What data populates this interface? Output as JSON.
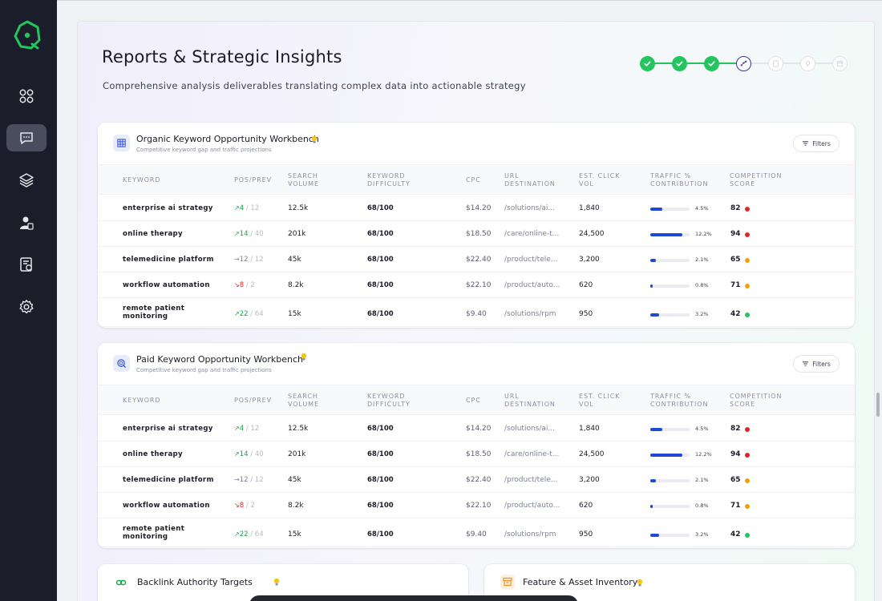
{
  "header": {
    "title": "Reports & Strategic Insights",
    "subtitle": "Comprehensive analysis deliverables translating complex data into actionable strategy"
  },
  "sidebar": {
    "items": [
      {
        "name": "dashboard-grid-icon",
        "active": false
      },
      {
        "name": "chat-icon",
        "active": true
      },
      {
        "name": "layers-icon",
        "active": false
      },
      {
        "name": "user-icon",
        "active": false
      },
      {
        "name": "report-icon",
        "active": false
      },
      {
        "name": "gear-icon",
        "active": false
      }
    ]
  },
  "stepper": {
    "steps": [
      "done",
      "done",
      "done",
      "current",
      "future",
      "future",
      "future"
    ]
  },
  "columns": {
    "keyword": "KEYWORD",
    "pos": "POS/PREV",
    "volume_1": "SEARCH",
    "volume_2": "VOLUME",
    "difficulty_1": "KEYWORD",
    "difficulty_2": "DIFFICULTY",
    "cpc": "CPC",
    "url_1": "URL",
    "url_2": "DESTINATION",
    "click_1": "EST. CLICK",
    "click_2": "VOL",
    "traffic_1": "TRAFFIC %",
    "traffic_2": "CONTRIBUTION",
    "competition_1": "COMPETITION",
    "competition_2": "SCORE"
  },
  "organic": {
    "title": "Organic Keyword Opportunity Workbench",
    "subtitle": "Competitive keyword gap and traffic projections",
    "filters_label": "Filters",
    "rows": [
      {
        "kw1": "enterprise ai strategy",
        "kw2": "",
        "dir": "up",
        "arrow": "↗",
        "pos": "4",
        "prev": "/ 12",
        "vol": "12.5k",
        "diff": "68/100",
        "cpc": "$14.20",
        "url": "/solutions/ai...",
        "click": "1,840",
        "traffic": 4.5,
        "pct": "4.5%",
        "score": "82",
        "color": "#dc2626"
      },
      {
        "kw1": "online therapy",
        "kw2": "",
        "dir": "up",
        "arrow": "↗",
        "pos": "14",
        "prev": "/ 40",
        "vol": "201k",
        "diff": "68/100",
        "cpc": "$18.50",
        "url": "/care/online-t...",
        "click": "24,500",
        "traffic": 12.2,
        "pct": "12.2%",
        "score": "94",
        "color": "#dc2626"
      },
      {
        "kw1": "telemedicine platform",
        "kw2": "",
        "dir": "flat",
        "arrow": "→",
        "pos": "12",
        "prev": "/ 12",
        "vol": "45k",
        "diff": "68/100",
        "cpc": "$22.40",
        "url": "/product/tele...",
        "click": "3,200",
        "traffic": 2.1,
        "pct": "2.1%",
        "score": "65",
        "color": "#f59e0b"
      },
      {
        "kw1": "workflow automation",
        "kw2": "",
        "dir": "down",
        "arrow": "↘",
        "pos": "8",
        "prev": "/ 2",
        "vol": "8.2k",
        "diff": "68/100",
        "cpc": "$22.10",
        "url": "/product/auto...",
        "click": "620",
        "traffic": 0.8,
        "pct": "0.8%",
        "score": "71",
        "color": "#f59e0b"
      },
      {
        "kw1": "remote patient",
        "kw2": "monitoring",
        "dir": "up",
        "arrow": "↗",
        "pos": "22",
        "prev": "/ 64",
        "vol": "15k",
        "diff": "68/100",
        "cpc": "$9.40",
        "url": "/solutions/rpm",
        "click": "950",
        "traffic": 3.2,
        "pct": "3.2%",
        "score": "42",
        "color": "#22c55e"
      }
    ]
  },
  "paid": {
    "title": "Paid Keyword Opportunity Workbench",
    "subtitle": "Competitive keyword gap and traffic projections",
    "filters_label": "Filters",
    "rows": [
      {
        "kw1": "enterprise ai strategy",
        "kw2": "",
        "dir": "up",
        "arrow": "↗",
        "pos": "4",
        "prev": "/ 12",
        "vol": "12.5k",
        "diff": "68/100",
        "cpc": "$14.20",
        "url": "/solutions/ai...",
        "click": "1,840",
        "traffic": 4.5,
        "pct": "4.5%",
        "score": "82",
        "color": "#dc2626"
      },
      {
        "kw1": "online therapy",
        "kw2": "",
        "dir": "up",
        "arrow": "↗",
        "pos": "14",
        "prev": "/ 40",
        "vol": "201k",
        "diff": "68/100",
        "cpc": "$18.50",
        "url": "/care/online-t...",
        "click": "24,500",
        "traffic": 12.2,
        "pct": "12.2%",
        "score": "94",
        "color": "#dc2626"
      },
      {
        "kw1": "telemedicine platform",
        "kw2": "",
        "dir": "flat",
        "arrow": "→",
        "pos": "12",
        "prev": "/ 12",
        "vol": "45k",
        "diff": "68/100",
        "cpc": "$22.40",
        "url": "/product/tele...",
        "click": "3,200",
        "traffic": 2.1,
        "pct": "2.1%",
        "score": "65",
        "color": "#f59e0b"
      },
      {
        "kw1": "workflow automation",
        "kw2": "",
        "dir": "down",
        "arrow": "↘",
        "pos": "8",
        "prev": "/ 2",
        "vol": "8.2k",
        "diff": "68/100",
        "cpc": "$22.10",
        "url": "/product/auto...",
        "click": "620",
        "traffic": 0.8,
        "pct": "0.8%",
        "score": "71",
        "color": "#f59e0b"
      },
      {
        "kw1": "remote patient",
        "kw2": "monitoring",
        "dir": "up",
        "arrow": "↗",
        "pos": "22",
        "prev": "/ 64",
        "vol": "15k",
        "diff": "68/100",
        "cpc": "$9.40",
        "url": "/solutions/rpm",
        "click": "950",
        "traffic": 3.2,
        "pct": "3.2%",
        "score": "42",
        "color": "#22c55e"
      }
    ]
  },
  "backlinks": {
    "title": "Backlink Authority Targets"
  },
  "assets": {
    "title": "Feature & Asset Inventory"
  },
  "colors": {
    "accent": "#1e49d8",
    "success": "#22c55e",
    "danger": "#dc2626",
    "warning": "#f59e0b",
    "sidebar": "#1b1d2a"
  }
}
